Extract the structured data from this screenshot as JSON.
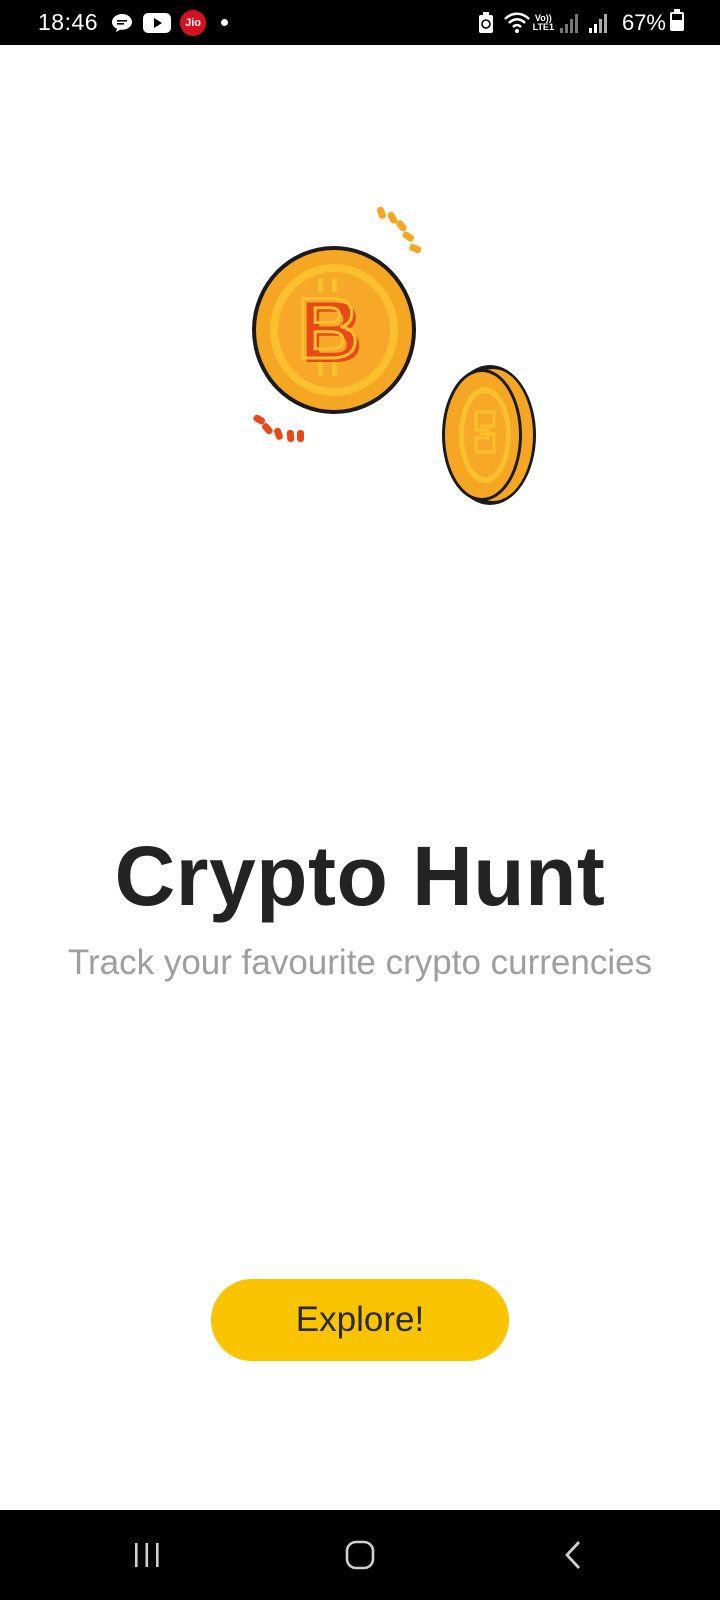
{
  "status_bar": {
    "time": "18:46",
    "carrier_badge": "Jio",
    "battery_percent": "67%",
    "network_label_top": "Vo))",
    "network_label_bottom": "LTE1",
    "icons": [
      "message-icon",
      "youtube-icon",
      "jio-icon",
      "notification-dot",
      "battery-saver-icon",
      "wifi-icon",
      "signal-icon",
      "signal-icon-2",
      "battery-icon"
    ]
  },
  "main": {
    "title": "Crypto Hunt",
    "subtitle": "Track your favourite crypto currencies",
    "explore_label": "Explore!"
  },
  "nav_bar": {
    "icons": [
      "recents-icon",
      "home-icon",
      "back-icon"
    ]
  },
  "colors": {
    "accent": "#fac400",
    "title": "#232323",
    "subtitle": "#9e9e9e",
    "coin_outer": "#f5a623",
    "coin_inner": "#fbc02d",
    "coin_symbol": "#e64a19"
  }
}
